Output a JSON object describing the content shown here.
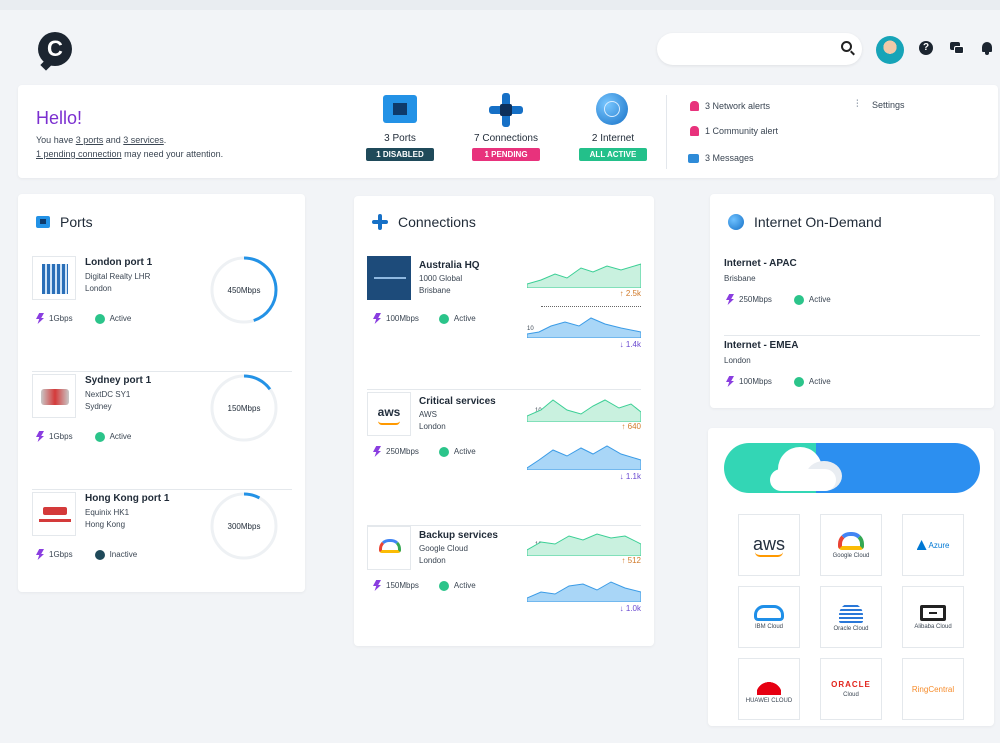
{
  "header": {
    "logo_letter": "C",
    "search_placeholder": "",
    "help_glyph": "?"
  },
  "hello": {
    "title": "Hello!",
    "line1_prefix": "You have ",
    "line1_link1": "3 ports",
    "line1_mid": " and ",
    "line1_link2": "3 services",
    "line1_suffix": ".",
    "line2_link": "1 pending connection",
    "line2_suffix": " may need your attention."
  },
  "stats": [
    {
      "label": "3 Ports",
      "pill": "1 DISABLED",
      "pill_color": "#1f4a5a"
    },
    {
      "label": "7 Connections",
      "pill": "1 PENDING",
      "pill_color": "#e8327c"
    },
    {
      "label": "2 Internet",
      "pill": "ALL ACTIVE",
      "pill_color": "#23c08a"
    }
  ],
  "notifications": {
    "alerts": "3 Network alerts",
    "community": "1 Community alert",
    "messages": "3 Messages",
    "settings": "Settings"
  },
  "ports": {
    "title": "Ports",
    "items": [
      {
        "name": "London port 1",
        "line1": "Digital Realty LHR",
        "line2": "London",
        "speed": "1Gbps",
        "status": "Active",
        "status_color": "#2bc48a",
        "ring_label": "450Mbps",
        "usage": 0.45
      },
      {
        "name": "Sydney port 1",
        "line1": "NextDC SY1",
        "line2": "Sydney",
        "speed": "1Gbps",
        "status": "Active",
        "status_color": "#2bc48a",
        "ring_label": "150Mbps",
        "usage": 0.15
      },
      {
        "name": "Hong Kong port 1",
        "line1": "Equinix HK1",
        "line2": "Hong Kong",
        "speed": "1Gbps",
        "status": "Inactive",
        "status_color": "#1f4a5a",
        "ring_label": "300Mbps",
        "usage": 0.08
      }
    ]
  },
  "connections": {
    "title": "Connections",
    "items": [
      {
        "name": "Australia HQ",
        "line1": "1000 Global",
        "line2": "Brisbane",
        "speed": "100Mbps",
        "status": "Active",
        "up_rate": "2.5k",
        "down_rate": "1.4k",
        "up_tick": "",
        "down_tick": "10"
      },
      {
        "name": "Critical services",
        "line1": "AWS",
        "line2": "London",
        "speed": "250Mbps",
        "status": "Active",
        "up_rate": "640",
        "down_rate": "1.1k",
        "up_tick": "10",
        "down_tick": ""
      },
      {
        "name": "Backup services",
        "line1": "Google Cloud",
        "line2": "London",
        "speed": "150Mbps",
        "status": "Active",
        "up_rate": "512",
        "down_rate": "1.0k",
        "up_tick": "10",
        "down_tick": ""
      }
    ],
    "status_color": "#2bc48a"
  },
  "internet": {
    "title": "Internet On-Demand",
    "items": [
      {
        "name": "Internet - APAC",
        "location": "Brisbane",
        "speed": "250Mbps",
        "status": "Active"
      },
      {
        "name": "Internet - EMEA",
        "location": "London",
        "speed": "100Mbps",
        "status": "Active"
      }
    ],
    "status_color": "#2bc48a"
  },
  "cloud": {
    "tiles": [
      {
        "name": "aws",
        "label": "",
        "icon": "aws-icon"
      },
      {
        "name": "google-cloud",
        "label": "Google Cloud",
        "icon": "google-cloud-icon"
      },
      {
        "name": "azure",
        "label": "",
        "icon": "azure-icon"
      },
      {
        "name": "ibm-cloud",
        "label": "IBM Cloud",
        "icon": "ibm-cloud-icon"
      },
      {
        "name": "oracle-cloud",
        "label": "Oracle Cloud",
        "icon": "oracle-cloud-icon"
      },
      {
        "name": "alibaba-cloud",
        "label": "Alibaba Cloud",
        "icon": "alibaba-cloud-icon"
      },
      {
        "name": "huawei-cloud",
        "label": "HUAWEI CLOUD",
        "icon": "huawei-icon"
      },
      {
        "name": "oracle",
        "label": "ORACLE",
        "icon": "oracle-icon"
      },
      {
        "name": "ringcentral",
        "label": "RingCentral",
        "icon": "ringcentral-icon"
      }
    ],
    "aws_text": "aws",
    "azure_text": "Azure",
    "oracle_sub": "Cloud"
  }
}
